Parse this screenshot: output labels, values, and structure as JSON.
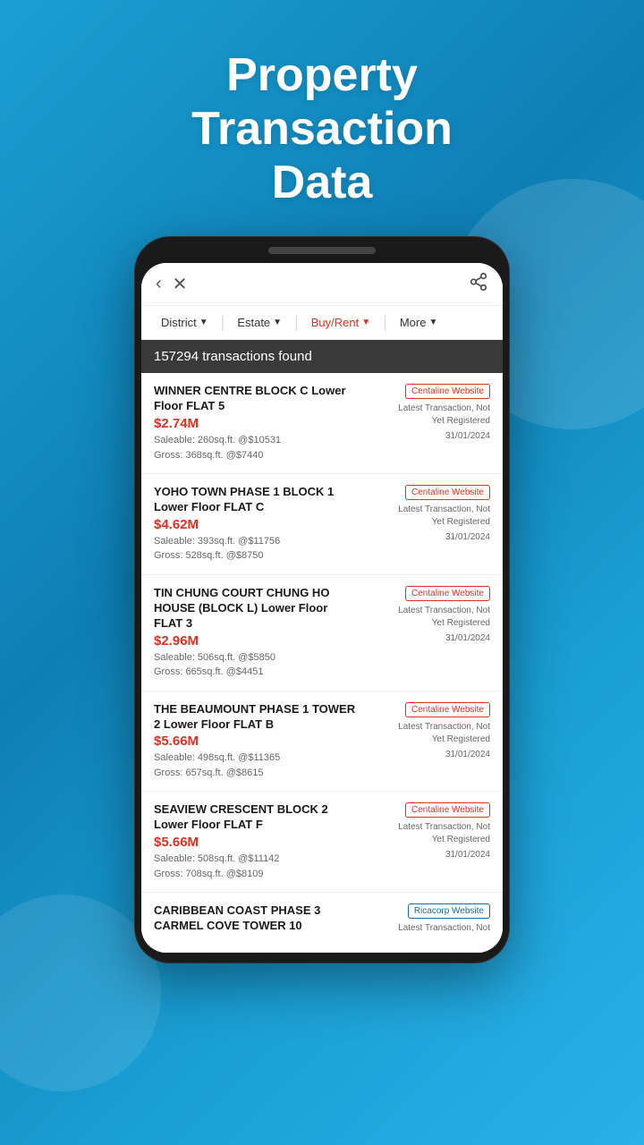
{
  "header": {
    "title": "Property\nTransaction\nData"
  },
  "nav": {
    "back_icon": "‹",
    "close_icon": "✕",
    "share_icon": "⎋"
  },
  "filters": [
    {
      "id": "district",
      "label": "District",
      "active": false
    },
    {
      "id": "estate",
      "label": "Estate",
      "active": false
    },
    {
      "id": "buyrent",
      "label": "Buy/Rent",
      "active": true
    },
    {
      "id": "more",
      "label": "More",
      "active": false
    }
  ],
  "count_bar": {
    "text": "157294 transactions found"
  },
  "transactions": [
    {
      "id": 1,
      "name": "WINNER CENTRE BLOCK C Lower Floor FLAT 5",
      "price": "$2.74M",
      "saleable": "Saleable: 260sq.ft. @$10531",
      "gross": "Gross: 368sq.ft. @$7440",
      "website_label": "Centaline Website",
      "website_type": "centaline",
      "status": "Latest Transaction, Not\nYet Registered",
      "date": "31/01/2024"
    },
    {
      "id": 2,
      "name": "YOHO TOWN PHASE 1 BLOCK 1 Lower Floor FLAT C",
      "price": "$4.62M",
      "saleable": "Saleable: 393sq.ft. @$11756",
      "gross": "Gross: 528sq.ft. @$8750",
      "website_label": "Centaline Website",
      "website_type": "centaline",
      "status": "Latest Transaction, Not\nYet Registered",
      "date": "31/01/2024"
    },
    {
      "id": 3,
      "name": "TIN CHUNG COURT CHUNG HO HOUSE (BLOCK L) Lower Floor FLAT 3",
      "price": "$2.96M",
      "saleable": "Saleable: 506sq.ft. @$5850",
      "gross": "Gross: 665sq.ft. @$4451",
      "website_label": "Centaline Website",
      "website_type": "centaline",
      "status": "Latest Transaction, Not\nYet Registered",
      "date": "31/01/2024"
    },
    {
      "id": 4,
      "name": "THE BEAUMOUNT PHASE 1 TOWER 2 Lower Floor FLAT B",
      "price": "$5.66M",
      "saleable": "Saleable: 498sq.ft. @$11365",
      "gross": "Gross: 657sq.ft. @$8615",
      "website_label": "Centaline Website",
      "website_type": "centaline",
      "status": "Latest Transaction, Not\nYet Registered",
      "date": "31/01/2024"
    },
    {
      "id": 5,
      "name": "SEAVIEW CRESCENT BLOCK 2 Lower Floor FLAT F",
      "price": "$5.66M",
      "saleable": "Saleable: 508sq.ft. @$11142",
      "gross": "Gross: 708sq.ft. @$8109",
      "website_label": "Centaline Website",
      "website_type": "centaline",
      "status": "Latest Transaction, Not\nYet Registered",
      "date": "31/01/2024"
    },
    {
      "id": 6,
      "name": "CARIBBEAN COAST PHASE 3 CARMEL COVE TOWER 10",
      "price": "",
      "saleable": "",
      "gross": "",
      "website_label": "Ricacorp Website",
      "website_type": "ricacorp",
      "status": "Latest Transaction, Not",
      "date": ""
    }
  ]
}
